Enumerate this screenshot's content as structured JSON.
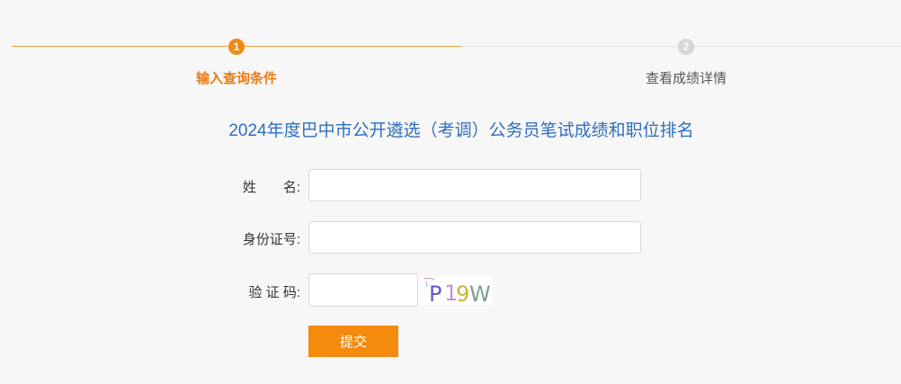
{
  "steps": [
    {
      "number": "1",
      "label": "输入查询条件",
      "state": "active"
    },
    {
      "number": "2",
      "label": "查看成绩详情",
      "state": "inactive"
    }
  ],
  "page_title": "2024年度巴中市公开遴选（考调）公务员笔试成绩和职位排名",
  "form": {
    "name_label": "姓　　名:",
    "name_value": "",
    "id_label": "身份证号:",
    "id_value": "",
    "captcha_label": "验 证 码:",
    "captcha_value": "",
    "captcha_text": "P19W",
    "submit_label": "提交"
  },
  "colors": {
    "accent": "#f08a13",
    "title": "#2f6fbf",
    "inactive": "#d6d6d6"
  }
}
